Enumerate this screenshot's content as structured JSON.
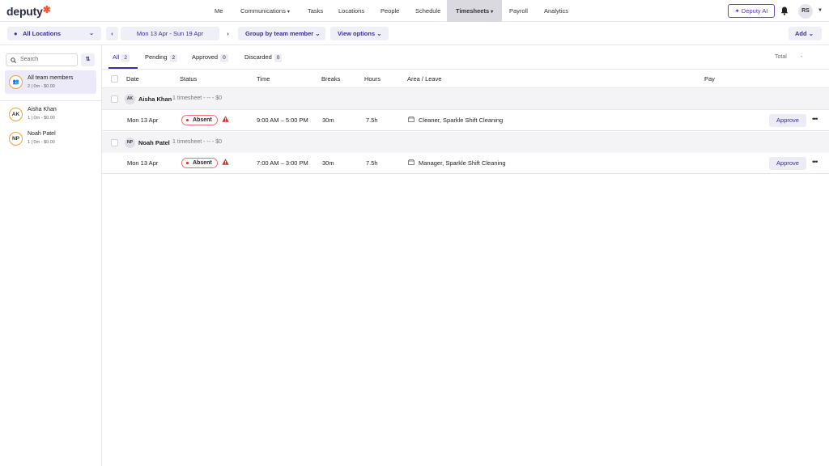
{
  "brand": {
    "logo": "deputy",
    "accent": "#f15a3a",
    "primary": "#3b2e8f"
  },
  "nav": {
    "items": [
      {
        "label": "Me"
      },
      {
        "label": "Communications",
        "caret": "▾"
      },
      {
        "label": "Tasks"
      },
      {
        "label": "Locations"
      },
      {
        "label": "People"
      },
      {
        "label": "Schedule"
      },
      {
        "label": "Timesheets",
        "caret": "▾",
        "active": true
      },
      {
        "label": "Payroll"
      },
      {
        "label": "Analytics"
      }
    ],
    "ai_label": "Deputy AI",
    "user_initials": "RS"
  },
  "toolbar": {
    "location": "All Locations",
    "date_range": "Mon 13 Apr - Sun 19 Apr",
    "group_by": "Group by team member",
    "view_options": "View options",
    "add": "Add"
  },
  "sidebar": {
    "search_placeholder": "Search",
    "all_members": {
      "name": "All team members",
      "sub": "2 | 0m - $0.00"
    },
    "members": [
      {
        "initials": "AK",
        "name": "Aisha Khan",
        "sub": "1 | 0m - $0.00"
      },
      {
        "initials": "NP",
        "name": "Noah Patel",
        "sub": "1 | 0m - $0.00"
      }
    ]
  },
  "tabs": [
    {
      "label": "All",
      "count": "2"
    },
    {
      "label": "Pending",
      "count": "2"
    },
    {
      "label": "Approved",
      "count": "0"
    },
    {
      "label": "Discarded",
      "count": "0"
    }
  ],
  "total": {
    "label": "Total",
    "value": "-"
  },
  "columns": [
    "Date",
    "Status",
    "Time",
    "Breaks",
    "Hours",
    "Area / Leave",
    "Pay"
  ],
  "groups": [
    {
      "initials": "AK",
      "name": "Aisha Khan",
      "summary": "1 timesheet - -- - $0",
      "row": {
        "date": "Mon 13 Apr",
        "status": "Absent",
        "time": "9:00 AM – 5:00 PM",
        "breaks": "30m",
        "hours": "7.5h",
        "area": "Cleaner, Sparkle Shift Cleaning",
        "action": "Approve"
      }
    },
    {
      "initials": "NP",
      "name": "Noah Patel",
      "summary": "1 timesheet - -- - $0",
      "row": {
        "date": "Mon 13 Apr",
        "status": "Absent",
        "time": "7:00 AM – 3:00 PM",
        "breaks": "30m",
        "hours": "7.5h",
        "area": "Manager, Sparkle Shift Cleaning",
        "action": "Approve"
      }
    }
  ]
}
